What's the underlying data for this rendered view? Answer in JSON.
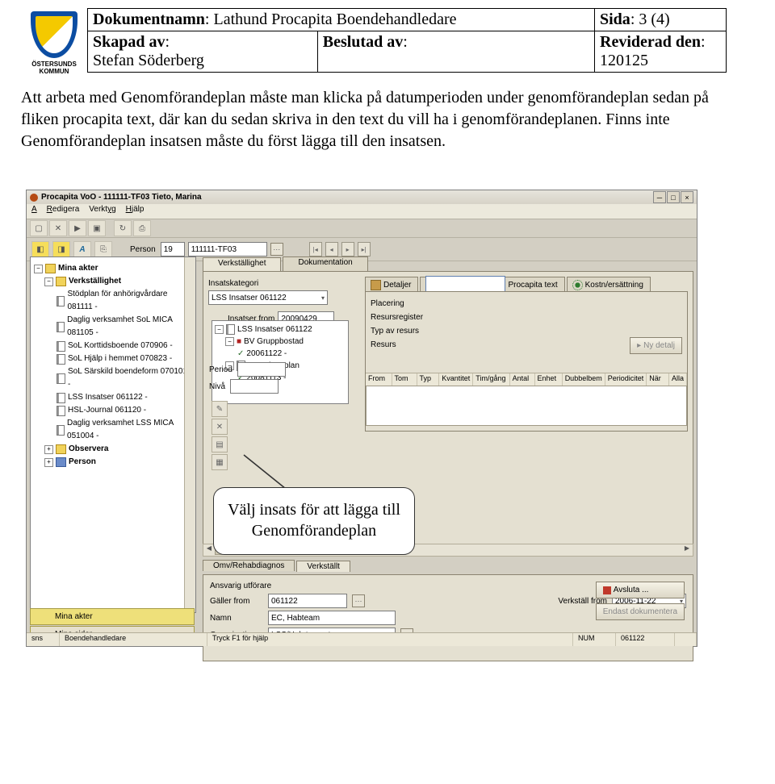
{
  "doc": {
    "dokumentnamn_lbl": "Dokumentnamn",
    "dokumentnamn_val": "Lathund Procapita Boendehandledare",
    "sida_lbl": "Sida",
    "sida_val": "3 (4)",
    "skapad_av_lbl": "Skapad av",
    "skapad_av_val": "Stefan Söderberg",
    "beslutad_av_lbl": "Beslutad av",
    "beslutad_av_val": "",
    "reviderad_den_lbl": "Reviderad den",
    "reviderad_den_val": "120125",
    "kommun_line1": "ÖSTERSUNDS",
    "kommun_line2": "KOMMUN",
    "body_text": "Att arbeta med Genomförandeplan måste man klicka på datumperioden under genomförandeplan sedan på fliken procapita text, där kan du sedan skriva in den text du vill ha i genomförandeplanen. Finns inte Genomförandeplan insatsen måste du först lägga till den insatsen.",
    "callout": "Välj insats för att lägga till Genomförandeplan"
  },
  "app": {
    "title": "Procapita VoO - 111111-TF03 Tieto, Marina",
    "menu": {
      "arkiv": "Arkiv",
      "redigera": "Redigera",
      "verktyg": "Verktyg",
      "hjalp": "Hjälp"
    },
    "person_lbl": "Person",
    "person_age": "19",
    "person_id": "111111-TF03",
    "sidebar_tab1": "Mina akter",
    "sidebar_tab2": "Mina sidor",
    "tree": {
      "root": "Mina akter",
      "verkstallighet": "Verkställighet",
      "items": [
        "Stödplan för anhörigvårdare 081111 -",
        "Daglig verksamhet SoL MICA 081105 -",
        "SoL Korttidsboende 070906 -",
        "SoL Hjälp i hemmet 070823 -",
        "SoL Särskild boendeform 070101 -",
        "LSS Insatser 061122 -",
        "HSL-Journal 061120 -",
        "Daglig verksamhet LSS MICA 051004 -"
      ],
      "observera": "Observera",
      "person": "Person"
    },
    "tabs_top": {
      "verkstallighet": "Verkställighet",
      "dokumentation": "Dokumentation"
    },
    "insatskategori_lbl": "Insatskategori",
    "insatskategori_val": "LSS Insatser 061122",
    "insatser_from_lbl": "Insatser from",
    "insatser_from_val": "20090429",
    "mini_tree": {
      "n1": "LSS Insatser 061122",
      "n2": "BV Gruppbostad",
      "n3": "20061122 -",
      "n4": "BV-Arbetsplan",
      "n5": "20081113 -"
    },
    "right_tabs": {
      "detaljer": "Detaljer",
      "procapita": "Procapita text",
      "kostn": "Kostn/ersättning"
    },
    "right_labels": {
      "placering": "Placering",
      "resursregister": "Resursregister",
      "typ": "Typ av resurs",
      "resurs": "Resurs"
    },
    "btn_ny_detalj": "Ny detalj",
    "period_lbl": "Period",
    "niva_lbl": "Nivå",
    "grid_cols": [
      "From",
      "Tom",
      "Typ",
      "Kvantitet",
      "Tim/gång",
      "Antal",
      "Enhet",
      "Dubbelbem",
      "Periodicitet",
      "När",
      "Alla"
    ],
    "lower_tabs": {
      "omv": "Omv/Rehabdiagnos",
      "verkstallt": "Verkställt"
    },
    "lower": {
      "ansvarig": "Ansvarig utförare",
      "galler_from_lbl": "Gäller from",
      "galler_from_val": "061122",
      "verkstall_from_lbl": "Verkställ from",
      "verkstall_from_val": "2006-11-22",
      "namn_lbl": "Namn",
      "namn_val": "EC, Habteam",
      "avsluta_btn": "Avsluta ...",
      "org_lbl": "Organisation",
      "org_val": "LSS/Hab teamet",
      "endast_btn": "Endast dokumentera"
    },
    "status": {
      "sns1": "sns",
      "user": "Boendehandledare",
      "help": "Tryck F1 för hjälp",
      "num": "NUM",
      "code": "061122"
    }
  }
}
